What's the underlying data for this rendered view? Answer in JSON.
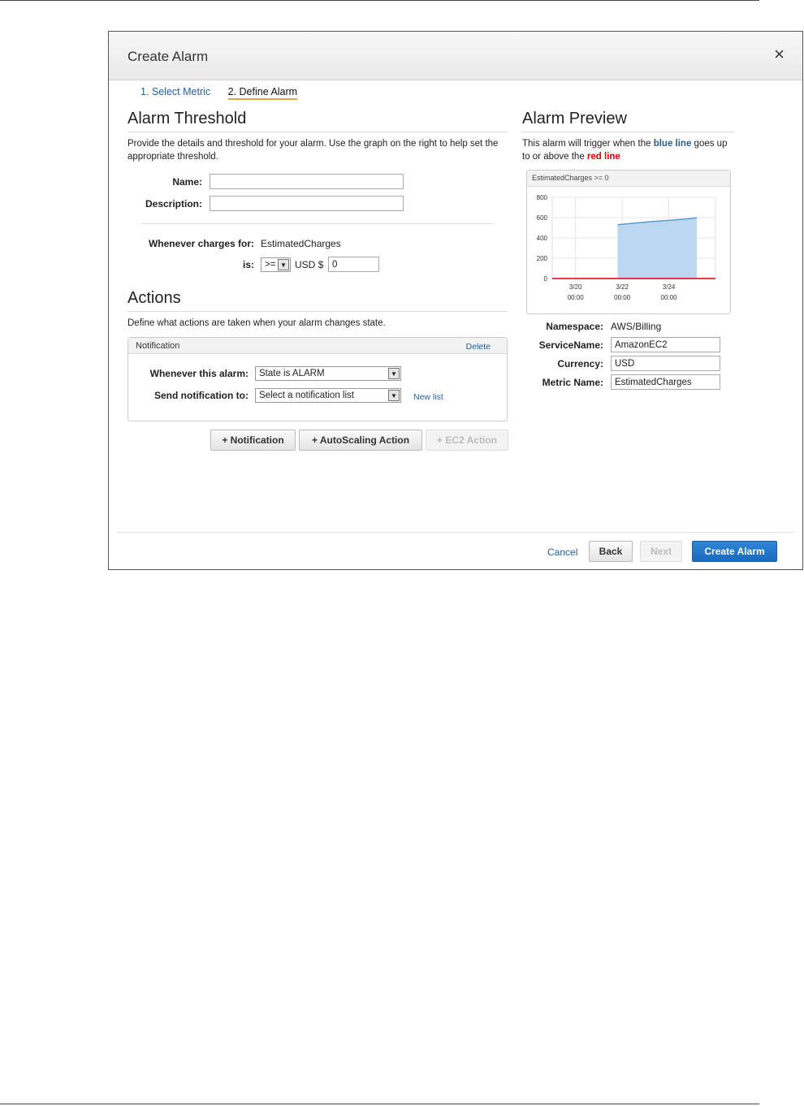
{
  "dialog": {
    "title": "Create Alarm",
    "close_glyph": "×",
    "steps": [
      {
        "label": "1. Select Metric"
      },
      {
        "label": "2. Define Alarm"
      }
    ]
  },
  "threshold": {
    "title": "Alarm Threshold",
    "description": "Provide the details and threshold for your alarm. Use the graph on the right to help set the appropriate threshold.",
    "name_label": "Name:",
    "name_value": "",
    "description_label": "Description:",
    "description_value": "",
    "charges_label": "Whenever charges for:",
    "charges_value": "EstimatedCharges",
    "is_label": "is:",
    "operator": ">=",
    "currency_prefix": "USD $",
    "threshold_value": "0"
  },
  "actions": {
    "title": "Actions",
    "description": "Define what actions are taken when your alarm changes state.",
    "notification": {
      "header": "Notification",
      "delete_label": "Delete",
      "state_label": "Whenever this alarm:",
      "state_value": "State is ALARM",
      "send_label": "Send notification to:",
      "send_value": "Select a notification list",
      "new_list_label": "New list"
    },
    "buttons": {
      "notification": "+ Notification",
      "autoscaling": "+ AutoScaling Action",
      "ec2": "+ EC2 Action"
    }
  },
  "preview": {
    "title": "Alarm Preview",
    "text_before": "This alarm will trigger when the ",
    "blue_text": "blue line",
    "text_middle": " goes up to or above the ",
    "red_text": "red line",
    "namespace_label": "Namespace:",
    "namespace_value": "AWS/Billing",
    "service_label": "ServiceName:",
    "service_value": "AmazonEC2",
    "currency_label": "Currency:",
    "currency_value": "USD",
    "metric_label": "Metric Name:",
    "metric_value": "EstimatedCharges"
  },
  "footer": {
    "cancel": "Cancel",
    "back": "Back",
    "next": "Next",
    "create": "Create Alarm"
  },
  "colors": {
    "blue_line": "#5b9bd5",
    "area_fill": "#bcd7f0",
    "red_line": "#e00000",
    "primary_button": "#1b69bb"
  },
  "chart_data": {
    "type": "area",
    "title": "EstimatedCharges >= 0",
    "x_ticks": [
      {
        "date": "3/20",
        "time": "00:00"
      },
      {
        "date": "3/22",
        "time": "00:00"
      },
      {
        "date": "3/24",
        "time": "00:00"
      }
    ],
    "y_ticks": [
      0,
      200,
      400,
      600,
      800
    ],
    "ylim": [
      0,
      800
    ],
    "xlim": [
      0,
      7
    ],
    "series": [
      {
        "x": [
          2.8,
          3.5,
          4.2,
          5.0,
          5.6,
          6.0,
          6.2
        ],
        "y": [
          530,
          545,
          560,
          573,
          584,
          592,
          600
        ]
      }
    ],
    "threshold": 0
  }
}
